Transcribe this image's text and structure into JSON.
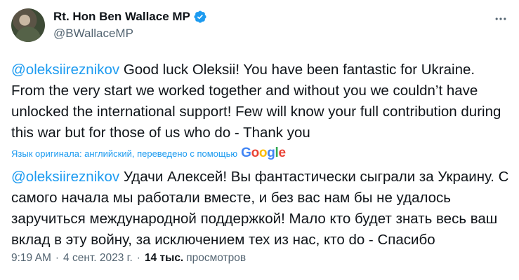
{
  "author": {
    "display_name": "Rt. Hon Ben Wallace MP",
    "handle": "@BWallaceMP",
    "verified_icon": "verified-badge-icon",
    "verified_color": "#1d9bf0"
  },
  "tweet": {
    "original": {
      "mention": "@oleksiireznikov",
      "text": " Good luck Oleksii! You have been fantastic for Ukraine. From the very start we worked together and without you we couldn’t have unlocked the international support! Few will know your full contribution during this war but for those of us who do - Thank you"
    },
    "translation_note": "Язык оригинала: английский, переведено с помощью",
    "translation_provider": {
      "letters": [
        "G",
        "o",
        "o",
        "g",
        "l",
        "e"
      ]
    },
    "translated": {
      "mention": "@oleksiireznikov",
      "text": " Удачи Алексей! Вы фантастически сыграли за Украину. С самого начала мы работали вместе, и без вас нам бы не удалось заручиться международной поддержкой! Мало кто будет знать весь ваш вклад в эту войну, за исключением тех из нас, кто do - Спасибо"
    }
  },
  "meta": {
    "time": "9:19 AM",
    "separator": "·",
    "date": "4 сент. 2023 г.",
    "views_count": "14 тыс.",
    "views_label": "просмотров"
  },
  "colors": {
    "accent": "#1d9bf0",
    "text": "#0f1419",
    "secondary": "#536471"
  }
}
